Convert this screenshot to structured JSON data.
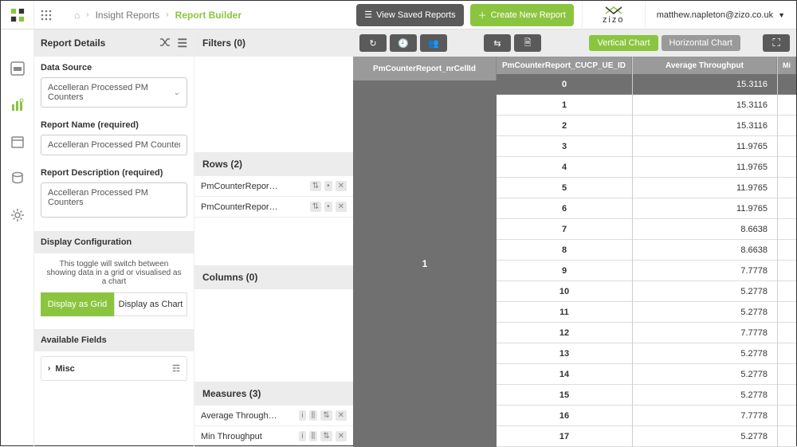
{
  "header": {
    "breadcrumbs": {
      "home": "Insight Reports",
      "current": "Report Builder"
    },
    "buttons": {
      "saved": "View Saved Reports",
      "create": "Create New Report"
    },
    "brand": "zizo",
    "user": "matthew.napleton@zizo.co.uk"
  },
  "details": {
    "title": "Report Details",
    "dataSourceLabel": "Data Source",
    "dataSourceValue": "Accelleran Processed PM Counters",
    "reportNameLabel": "Report Name (required)",
    "reportNameValue": "Accelleran Processed PM Counters",
    "reportDescLabel": "Report Description (required)",
    "reportDescValue": "Accelleran Processed PM Counters",
    "displayConfig": "Display Configuration",
    "displayHelp": "This toggle will switch between showing data in a grid or visualised as a chart",
    "displayGrid": "Display as Grid",
    "displayChart": "Display as Chart",
    "availableFields": "Available Fields",
    "misc": "Misc"
  },
  "builder": {
    "filters": "Filters (0)",
    "rows": "Rows (2)",
    "rowItems": [
      "PmCounterRepor…",
      "PmCounterRepor…"
    ],
    "columns": "Columns (0)",
    "measures": "Measures (3)",
    "measureItems": [
      "Average Through…",
      "Min Throughput"
    ]
  },
  "toolbar": {
    "vertical": "Vertical Chart",
    "horizontal": "Horizontal Chart"
  },
  "grid": {
    "headers": [
      "PmCounterReport_nrCellId",
      "PmCounterReport_CUCP_UE_ID",
      "Average Throughput",
      "Mi"
    ],
    "leftValue": "1",
    "rows": [
      {
        "id": "0",
        "val": "15.3116"
      },
      {
        "id": "1",
        "val": "15.3116"
      },
      {
        "id": "2",
        "val": "15.3116"
      },
      {
        "id": "3",
        "val": "11.9765"
      },
      {
        "id": "4",
        "val": "11.9765"
      },
      {
        "id": "5",
        "val": "11.9765"
      },
      {
        "id": "6",
        "val": "11.9765"
      },
      {
        "id": "7",
        "val": "8.6638"
      },
      {
        "id": "8",
        "val": "8.6638"
      },
      {
        "id": "9",
        "val": "7.7778"
      },
      {
        "id": "10",
        "val": "5.2778"
      },
      {
        "id": "11",
        "val": "5.2778"
      },
      {
        "id": "12",
        "val": "7.7778"
      },
      {
        "id": "13",
        "val": "5.2778"
      },
      {
        "id": "14",
        "val": "5.2778"
      },
      {
        "id": "15",
        "val": "5.2778"
      },
      {
        "id": "16",
        "val": "7.7778"
      },
      {
        "id": "17",
        "val": "5.2778"
      }
    ]
  }
}
